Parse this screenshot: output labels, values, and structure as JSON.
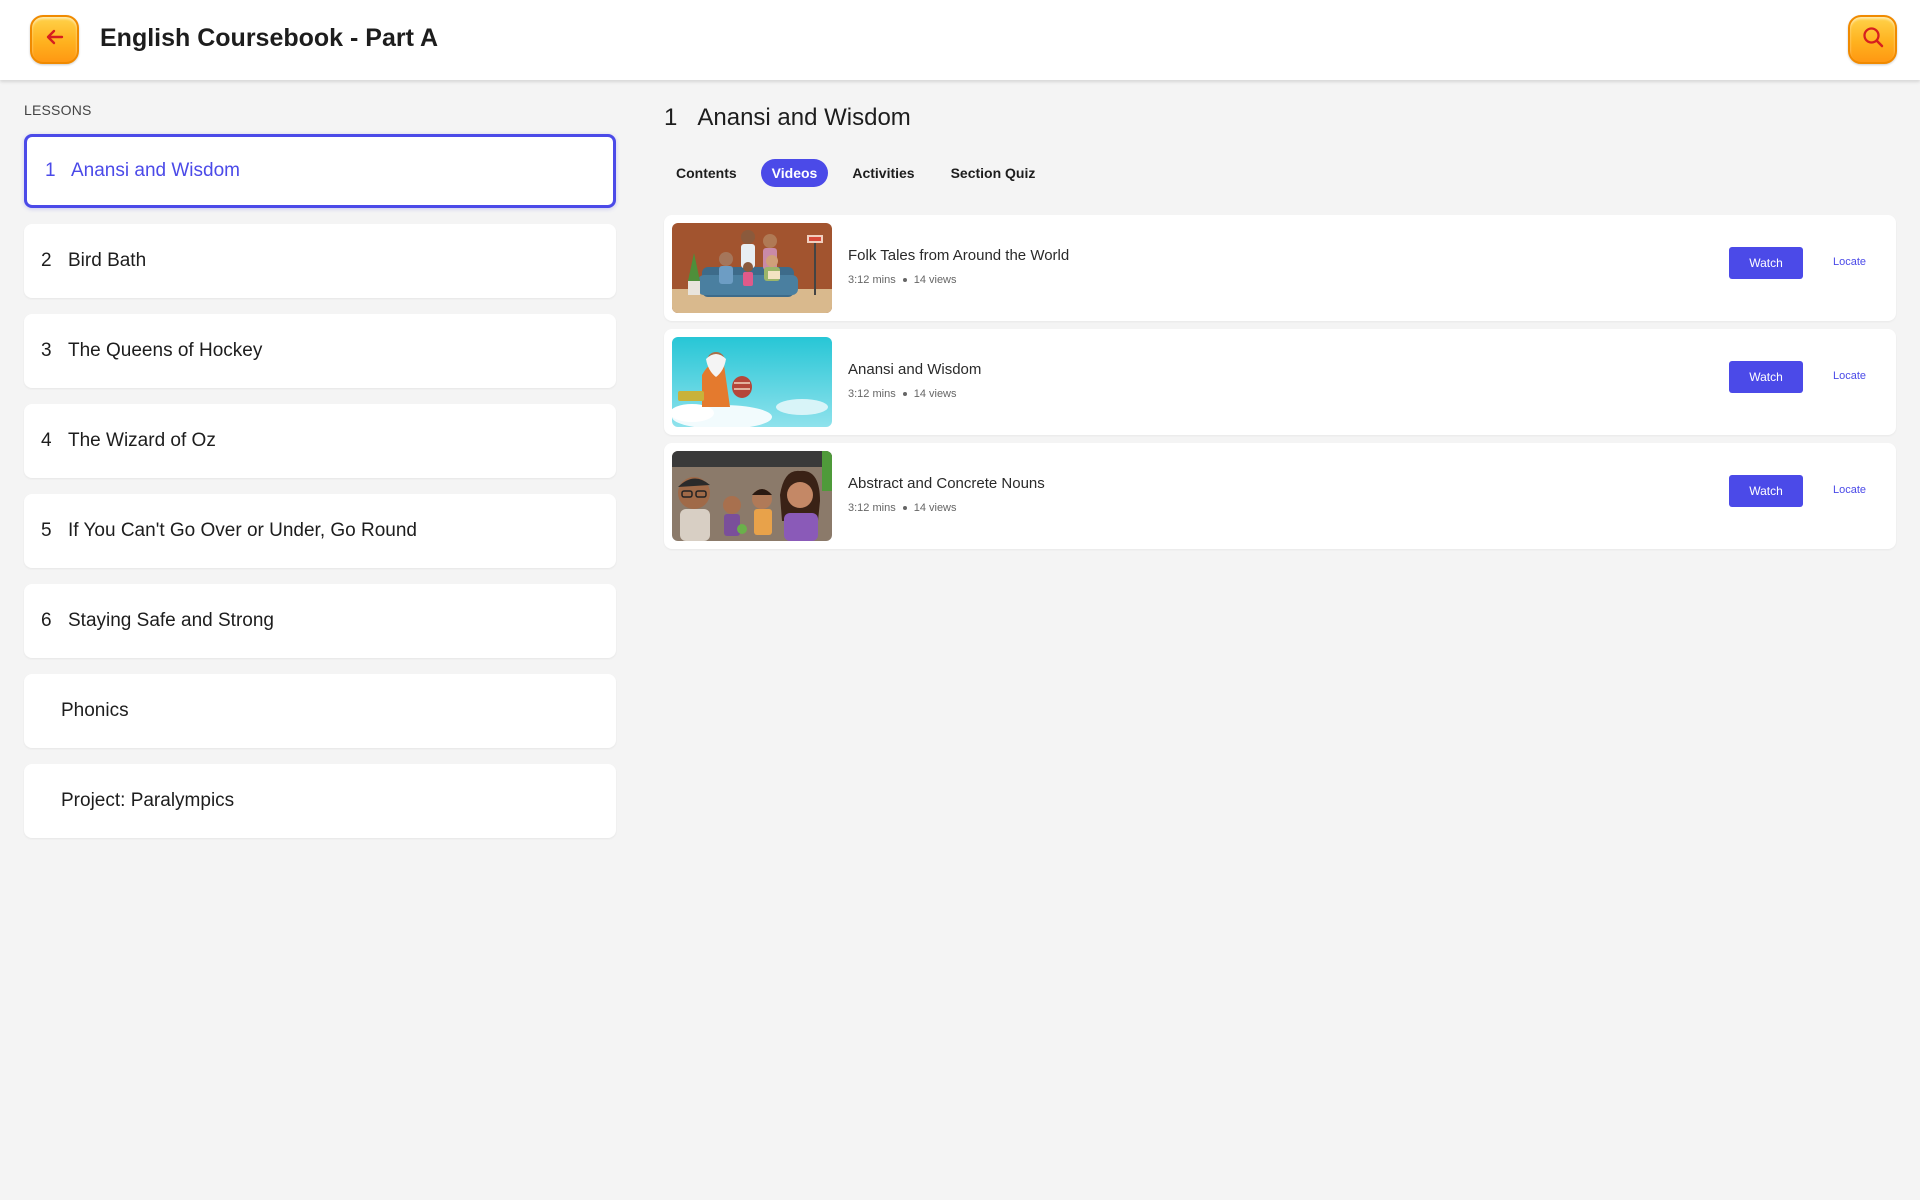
{
  "header": {
    "title": "English Coursebook - Part A",
    "back_icon": "arrow-left-icon",
    "search_icon": "search-icon",
    "accent_color": "#ffb21f"
  },
  "sidebar": {
    "heading": "LESSONS",
    "items": [
      {
        "num": "1",
        "label": "Anansi and Wisdom",
        "active": true
      },
      {
        "num": "2",
        "label": "Bird Bath"
      },
      {
        "num": "3",
        "label": "The Queens of Hockey"
      },
      {
        "num": "4",
        "label": "The Wizard of Oz"
      },
      {
        "num": "5",
        "label": "If You Can't Go Over or Under, Go Round"
      },
      {
        "num": "6",
        "label": "Staying Safe and Strong"
      },
      {
        "num": "",
        "label": "Phonics"
      },
      {
        "num": "",
        "label": "Project: Paralympics"
      }
    ]
  },
  "main": {
    "section_num": "1",
    "section_title": "Anansi and Wisdom",
    "tabs": [
      {
        "label": "Contents"
      },
      {
        "label": "Videos",
        "active": true
      },
      {
        "label": "Activities"
      },
      {
        "label": "Section Quiz"
      }
    ],
    "videos": [
      {
        "title": "Folk Tales from Around the World",
        "duration": "3:12 mins",
        "views": "14 views",
        "watch_label": "Watch",
        "locate_label": "Locate"
      },
      {
        "title": "Anansi and Wisdom",
        "duration": "3:12 mins",
        "views": "14 views",
        "watch_label": "Watch",
        "locate_label": "Locate"
      },
      {
        "title": "Abstract and Concrete Nouns",
        "duration": "3:12 mins",
        "views": "14 views",
        "watch_label": "Watch",
        "locate_label": "Locate"
      }
    ]
  },
  "colors": {
    "primary": "#4b4ae8",
    "background": "#f4f4f4"
  }
}
